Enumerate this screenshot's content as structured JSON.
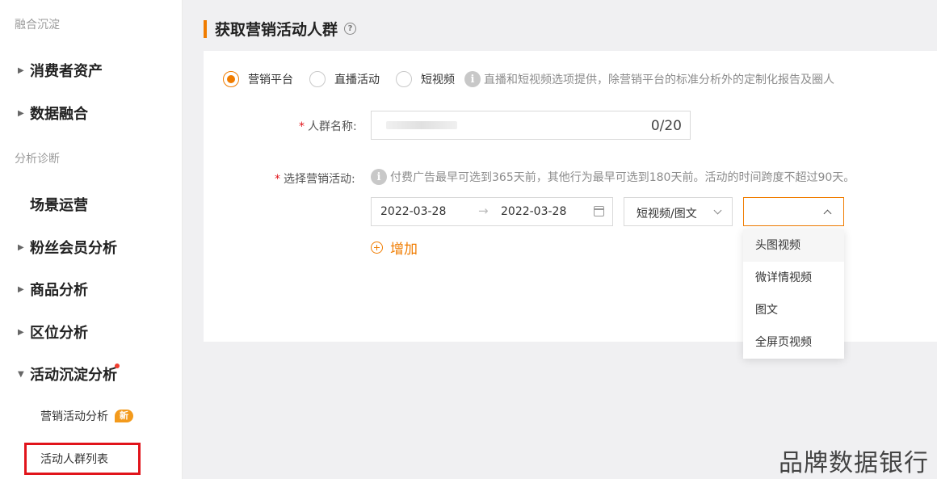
{
  "sidebar": {
    "section_fusion": "融合沉淀",
    "item_consumer_assets": "消费者资产",
    "item_data_fusion": "数据融合",
    "section_analysis": "分析诊断",
    "item_scene_ops": "场景运营",
    "item_fan_member": "粉丝会员分析",
    "item_product": "商品分析",
    "item_zone": "区位分析",
    "item_campaign": "活动沉淀分析",
    "sub_marketing_analysis": "营销活动分析",
    "sub_new_badge": "新",
    "sub_crowd_list": "活动人群列表"
  },
  "page": {
    "title": "获取营销活动人群",
    "help_glyph": "?"
  },
  "radios": {
    "option1": "营销平台",
    "option2": "直播活动",
    "option3": "短视频",
    "selected": "营销平台",
    "hint": "直播和短视频选项提供，除营销平台的标准分析外的定制化报告及圈人"
  },
  "form": {
    "required_mark": "*",
    "name_label": "人群名称:",
    "name_counter": "0/20",
    "activity_label": "选择营销活动:",
    "activity_hint": "付费广告最早可选到365天前，其他行为最早可选到180天前。活动的时间跨度不超过90天。",
    "date_start": "2022-03-28",
    "date_arrow": "→",
    "date_end": "2022-03-28",
    "type_value": "短视频/图文",
    "add_label": "增加"
  },
  "dropdown": {
    "items": [
      "头图视频",
      "微详情视频",
      "图文",
      "全屏页视频"
    ]
  },
  "watermark": "品牌数据银行",
  "colors": {
    "accent": "#f07c00",
    "required": "#e1141b",
    "badge": "#f39a1c"
  },
  "icons": {
    "help": "question-circle-icon",
    "info": "info-circle-icon",
    "calendar": "calendar-icon",
    "chevron": "chevron-icon",
    "plus": "plus-circle-icon"
  }
}
